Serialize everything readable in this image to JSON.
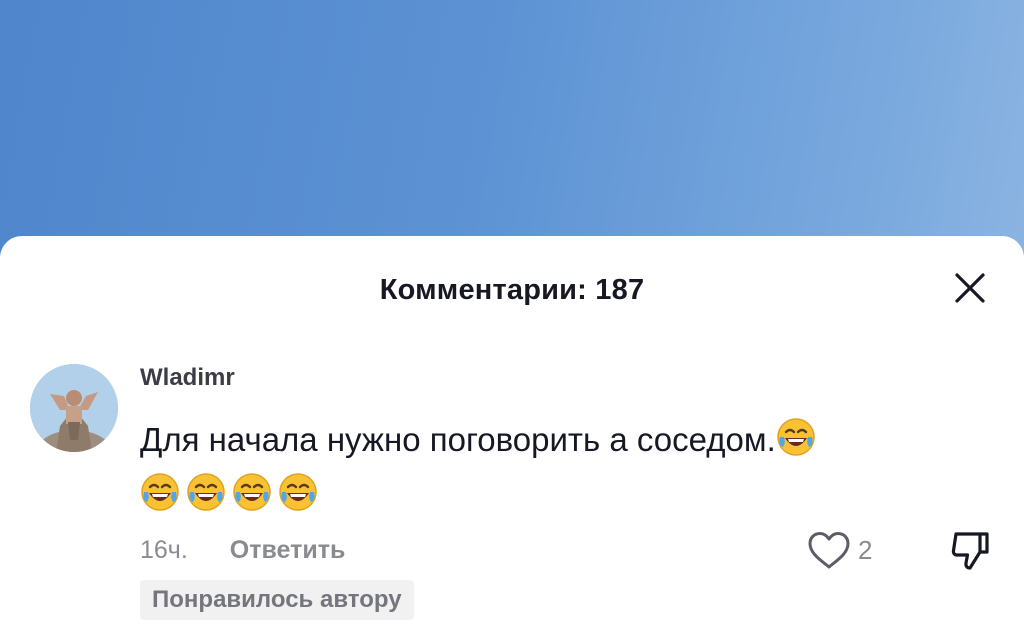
{
  "sheet": {
    "title": "Комментарии: 187",
    "close_icon": "close-icon"
  },
  "comment": {
    "username": "Wladimr",
    "text": "Для начала нужно поговорить а соседом.",
    "emoji_count": 5,
    "emoji_icon": "face-with-tears-of-joy-emoji",
    "timestamp": "16ч.",
    "reply_label": "Ответить",
    "like_count": "2",
    "like_icon": "heart-outline-icon",
    "dislike_icon": "thumbs-down-icon",
    "liked_by_author": "Понравилось автору"
  },
  "colors": {
    "background_gradient": [
      "#4f86cc",
      "#92b8e3"
    ],
    "sheet": "#ffffff",
    "title_text": "#161823",
    "secondary_text": "#8a8b91",
    "badge_bg": "#f1f1f2"
  }
}
